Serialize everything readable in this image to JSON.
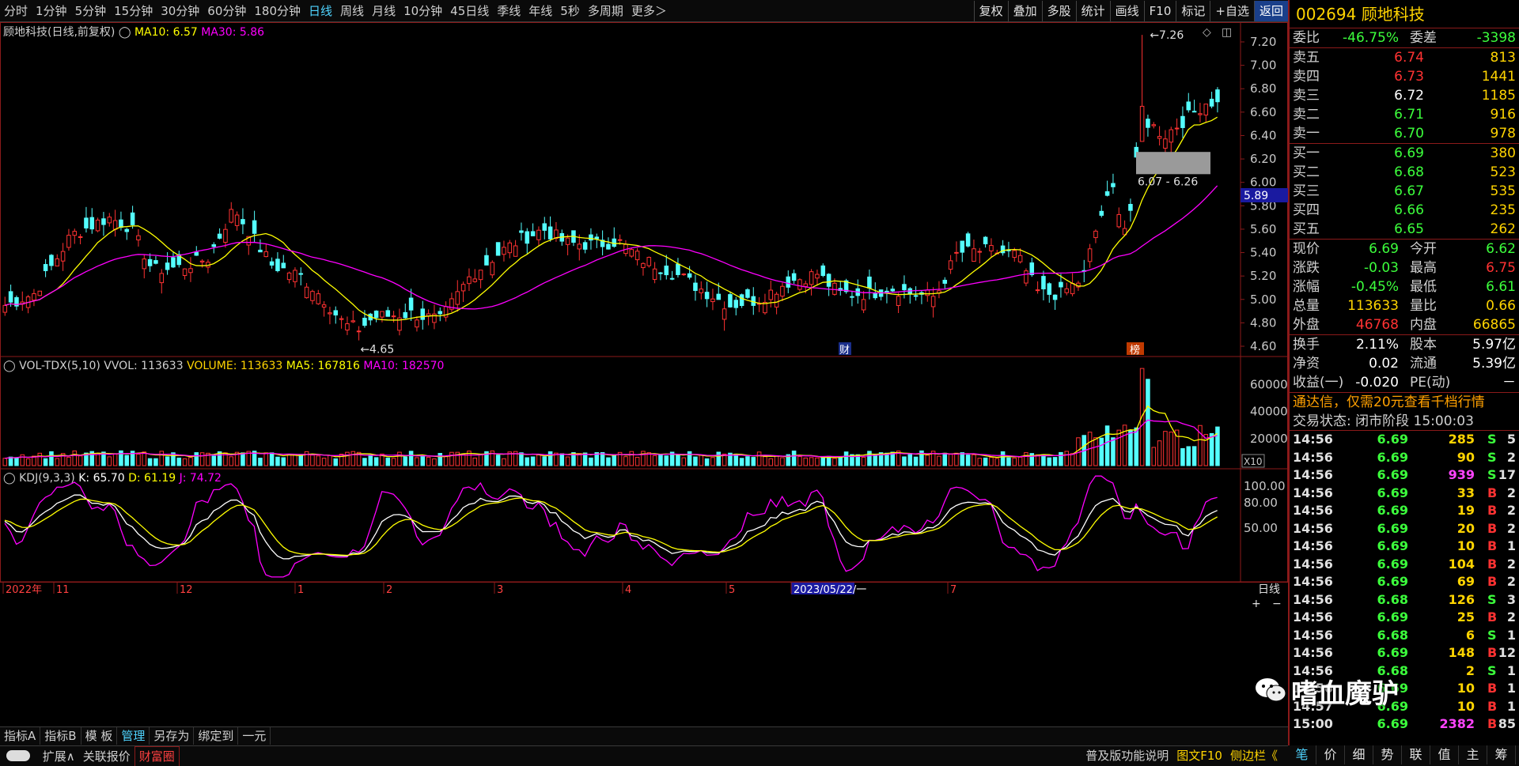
{
  "toolbar": {
    "period_tabs": [
      "分时",
      "1分钟",
      "5分钟",
      "15分钟",
      "30分钟",
      "60分钟",
      "180分钟",
      "日线",
      "周线",
      "月线",
      "10分钟",
      "45日线",
      "季线",
      "年线",
      "5秒",
      "多周期",
      "更多＞"
    ],
    "active_tab": "日线",
    "right_tools": [
      "复权",
      "叠加",
      "多股",
      "统计",
      "画线",
      "F10",
      "标记",
      "+自选",
      "返回"
    ]
  },
  "main_panel": {
    "title": "顾地科技(日线,前复权)",
    "ma10_label": "MA10: 6.57",
    "ma30_label": "MA30: 5.86",
    "price_ticks": [
      "7.20",
      "7.00",
      "6.80",
      "6.60",
      "6.40",
      "6.20",
      "6.00",
      "5.80",
      "5.60",
      "5.40",
      "5.20",
      "5.00",
      "4.80",
      "4.60"
    ],
    "current_price_tag": "5.89",
    "high_mark": "7.26",
    "low_mark": "4.65",
    "range_label": "6.07 - 6.26",
    "marker_cai": "财",
    "marker_bang": "榜",
    "colors": {
      "up": "#ff3232",
      "down": "#54ffff",
      "ma10": "#ffff00",
      "ma30": "#ff00ff",
      "grid": "#8b1a1a"
    }
  },
  "vol_panel": {
    "name": "VOL-TDX(5,10)",
    "vvol": "VVOL: 113633",
    "volume": "VOLUME: 113633",
    "ma5": "MA5: 167816",
    "ma10": "MA10: 182570",
    "ticks": [
      "60000",
      "40000",
      "20000"
    ],
    "unit": "X10"
  },
  "kdj_panel": {
    "name": "KDJ(9,3,3)",
    "k": "K: 65.70",
    "d": "D: 61.19",
    "j": "J: 74.72",
    "ticks": [
      "100.00",
      "80.00",
      "50.00"
    ]
  },
  "x_axis": {
    "labels": [
      "2022年",
      "11",
      "12",
      "1",
      "2",
      "3",
      "4",
      "5",
      "2023/05/22/一",
      "7"
    ],
    "period_label": "日线"
  },
  "bottom1": [
    "指标A",
    "指标B",
    "模 板",
    "管理",
    "另存为",
    "绑定到",
    "一元"
  ],
  "bottom1_active": "管理",
  "bottom2": {
    "left": [
      "扩展∧",
      "关联报价",
      "财富圈"
    ],
    "right": [
      "普及版功能说明",
      "图文F10",
      "侧边栏《"
    ]
  },
  "quote": {
    "code": "002694",
    "name": "顾地科技",
    "weibi_label": "委比",
    "weibi": "-46.75%",
    "weicha_label": "委差",
    "weicha": "-3398",
    "asks": [
      {
        "label": "卖五",
        "price": "6.74",
        "qty": "813",
        "color": "red"
      },
      {
        "label": "卖四",
        "price": "6.73",
        "qty": "1441",
        "color": "red"
      },
      {
        "label": "卖三",
        "price": "6.72",
        "qty": "1185",
        "color": "white"
      },
      {
        "label": "卖二",
        "price": "6.71",
        "qty": "916",
        "color": "green"
      },
      {
        "label": "卖一",
        "price": "6.70",
        "qty": "978",
        "color": "green"
      }
    ],
    "bids": [
      {
        "label": "买一",
        "price": "6.69",
        "qty": "380",
        "color": "green"
      },
      {
        "label": "买二",
        "price": "6.68",
        "qty": "523",
        "color": "green"
      },
      {
        "label": "买三",
        "price": "6.67",
        "qty": "535",
        "color": "green"
      },
      {
        "label": "买四",
        "price": "6.66",
        "qty": "235",
        "color": "green"
      },
      {
        "label": "买五",
        "price": "6.65",
        "qty": "262",
        "color": "green"
      }
    ],
    "stats": [
      {
        "l": "现价",
        "v": "6.69",
        "vc": "green",
        "l2": "今开",
        "v2": "6.62",
        "v2c": "green"
      },
      {
        "l": "涨跌",
        "v": "-0.03",
        "vc": "green",
        "l2": "最高",
        "v2": "6.75",
        "v2c": "red"
      },
      {
        "l": "涨幅",
        "v": "-0.45%",
        "vc": "green",
        "l2": "最低",
        "v2": "6.61",
        "v2c": "green"
      },
      {
        "l": "总量",
        "v": "113633",
        "vc": "yellow",
        "l2": "量比",
        "v2": "0.66",
        "v2c": "yellow"
      },
      {
        "l": "外盘",
        "v": "46768",
        "vc": "red",
        "l2": "内盘",
        "v2": "66865",
        "v2c": "yellow"
      }
    ],
    "stats2": [
      {
        "l": "换手",
        "v": "2.11%",
        "vc": "white",
        "l2": "股本",
        "v2": "5.97亿",
        "v2c": "white"
      },
      {
        "l": "净资",
        "v": "0.02",
        "vc": "white",
        "l2": "流通",
        "v2": "5.39亿",
        "v2c": "white"
      },
      {
        "l": "收益(一)",
        "v": "-0.020",
        "vc": "white",
        "l2": "PE(动)",
        "v2": "－",
        "v2c": "white"
      }
    ],
    "banner": "通达信，仅需20元查看千档行情",
    "trade_state": "交易状态: 闭市阶段 15:00:03",
    "ticks": [
      {
        "t": "14:56",
        "p": "6.69",
        "q": "285",
        "d": "S",
        "n": "5"
      },
      {
        "t": "14:56",
        "p": "6.69",
        "q": "90",
        "d": "S",
        "n": "2"
      },
      {
        "t": "14:56",
        "p": "6.69",
        "q": "939",
        "d": "S",
        "n": "17"
      },
      {
        "t": "14:56",
        "p": "6.69",
        "q": "33",
        "d": "B",
        "n": "2"
      },
      {
        "t": "14:56",
        "p": "6.69",
        "q": "19",
        "d": "B",
        "n": "2"
      },
      {
        "t": "14:56",
        "p": "6.69",
        "q": "20",
        "d": "B",
        "n": "2"
      },
      {
        "t": "14:56",
        "p": "6.69",
        "q": "10",
        "d": "B",
        "n": "1"
      },
      {
        "t": "14:56",
        "p": "6.69",
        "q": "104",
        "d": "B",
        "n": "2"
      },
      {
        "t": "14:56",
        "p": "6.69",
        "q": "69",
        "d": "B",
        "n": "2"
      },
      {
        "t": "14:56",
        "p": "6.68",
        "q": "126",
        "d": "S",
        "n": "3"
      },
      {
        "t": "14:56",
        "p": "6.69",
        "q": "25",
        "d": "B",
        "n": "2"
      },
      {
        "t": "14:56",
        "p": "6.68",
        "q": "6",
        "d": "S",
        "n": "1"
      },
      {
        "t": "14:56",
        "p": "6.69",
        "q": "148",
        "d": "B",
        "n": "12"
      },
      {
        "t": "14:56",
        "p": "6.68",
        "q": "2",
        "d": "S",
        "n": "1"
      },
      {
        "t": "14:56",
        "p": "6.69",
        "q": "10",
        "d": "B",
        "n": "1"
      },
      {
        "t": "14:57",
        "p": "6.69",
        "q": "10",
        "d": "B",
        "n": "1"
      },
      {
        "t": "15:00",
        "p": "6.69",
        "q": "2382",
        "d": "B",
        "n": "85"
      }
    ],
    "bottom_tabs": [
      "笔",
      "价",
      "细",
      "势",
      "联",
      "值",
      "主",
      "筹"
    ]
  },
  "watermark": "嗜血魔驴"
}
